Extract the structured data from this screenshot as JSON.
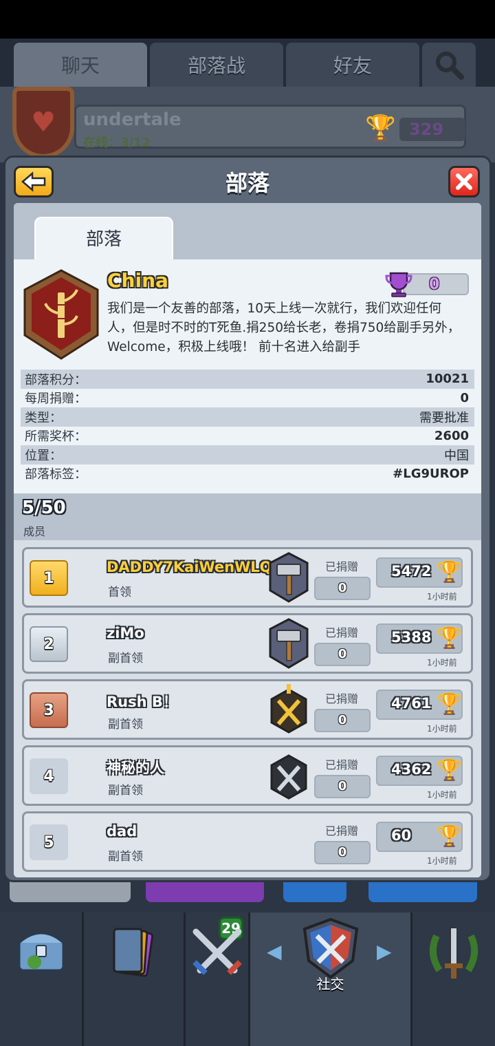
{
  "top_tabs": [
    "聊天",
    "部落战",
    "好友"
  ],
  "background_clan": {
    "name": "undertale",
    "online": "在线：3/12",
    "trophies": "329"
  },
  "modal": {
    "title": "部落",
    "back_icon": "back-arrow-icon",
    "close_icon": "close-icon",
    "tab": "部落"
  },
  "clan": {
    "name": "China",
    "trophies": "0",
    "description": "我们是一个友善的部落，10天上线一次就行，我们欢迎任何人，但是时不时的T死鱼.捐250给长老，卷捐750给副手另外，Welcome，积极上线哦！ 前十名进入给副手",
    "stats": [
      {
        "label": "部落积分：",
        "value": "10021"
      },
      {
        "label": "每周捐赠：",
        "value": "0"
      },
      {
        "label": "类型：",
        "value": "需要批准"
      },
      {
        "label": "所需奖杯：",
        "value": "2600"
      },
      {
        "label": "位置：",
        "value": "中国"
      },
      {
        "label": "部落标签：",
        "value": "#LG9UROP"
      }
    ]
  },
  "members_header": {
    "count": "5/50",
    "label": "成员"
  },
  "members": [
    {
      "rank": "1",
      "name": "DADDY7KaiWenWLQ",
      "role": "首领",
      "donate_label": "已捐赠",
      "donations": "0",
      "trophies": "5472",
      "last_seen": "1小时前",
      "arena_icon": "hammer-arena-icon"
    },
    {
      "rank": "2",
      "name": "ziMo",
      "role": "副首领",
      "donate_label": "已捐赠",
      "donations": "0",
      "trophies": "5388",
      "last_seen": "1小时前",
      "arena_icon": "hammer-arena-icon"
    },
    {
      "rank": "3",
      "name": "Rush B！",
      "role": "副首领",
      "donate_label": "已捐赠",
      "donations": "0",
      "trophies": "4761",
      "last_seen": "1小时前",
      "arena_icon": "gold-swords-arena-icon"
    },
    {
      "rank": "4",
      "name": "神秘的人",
      "role": "副首领",
      "donate_label": "已捐赠",
      "donations": "0",
      "trophies": "4362",
      "last_seen": "1小时前",
      "arena_icon": "silver-swords-arena-icon"
    },
    {
      "rank": "5",
      "name": "dad",
      "role": "副首领",
      "donate_label": "已捐赠",
      "donations": "0",
      "trophies": "60",
      "last_seen": "1小时前",
      "arena_icon": ""
    }
  ],
  "bottom_nav": {
    "cards_badge": "29",
    "social_label": "社交"
  },
  "colors": {
    "gold_name": "#ffcf3a",
    "trophy_gold": "#f2b418",
    "clan_trophy_purple": "#a14fd0",
    "close_red": "#e0241c",
    "back_yellow": "#f2a918"
  }
}
